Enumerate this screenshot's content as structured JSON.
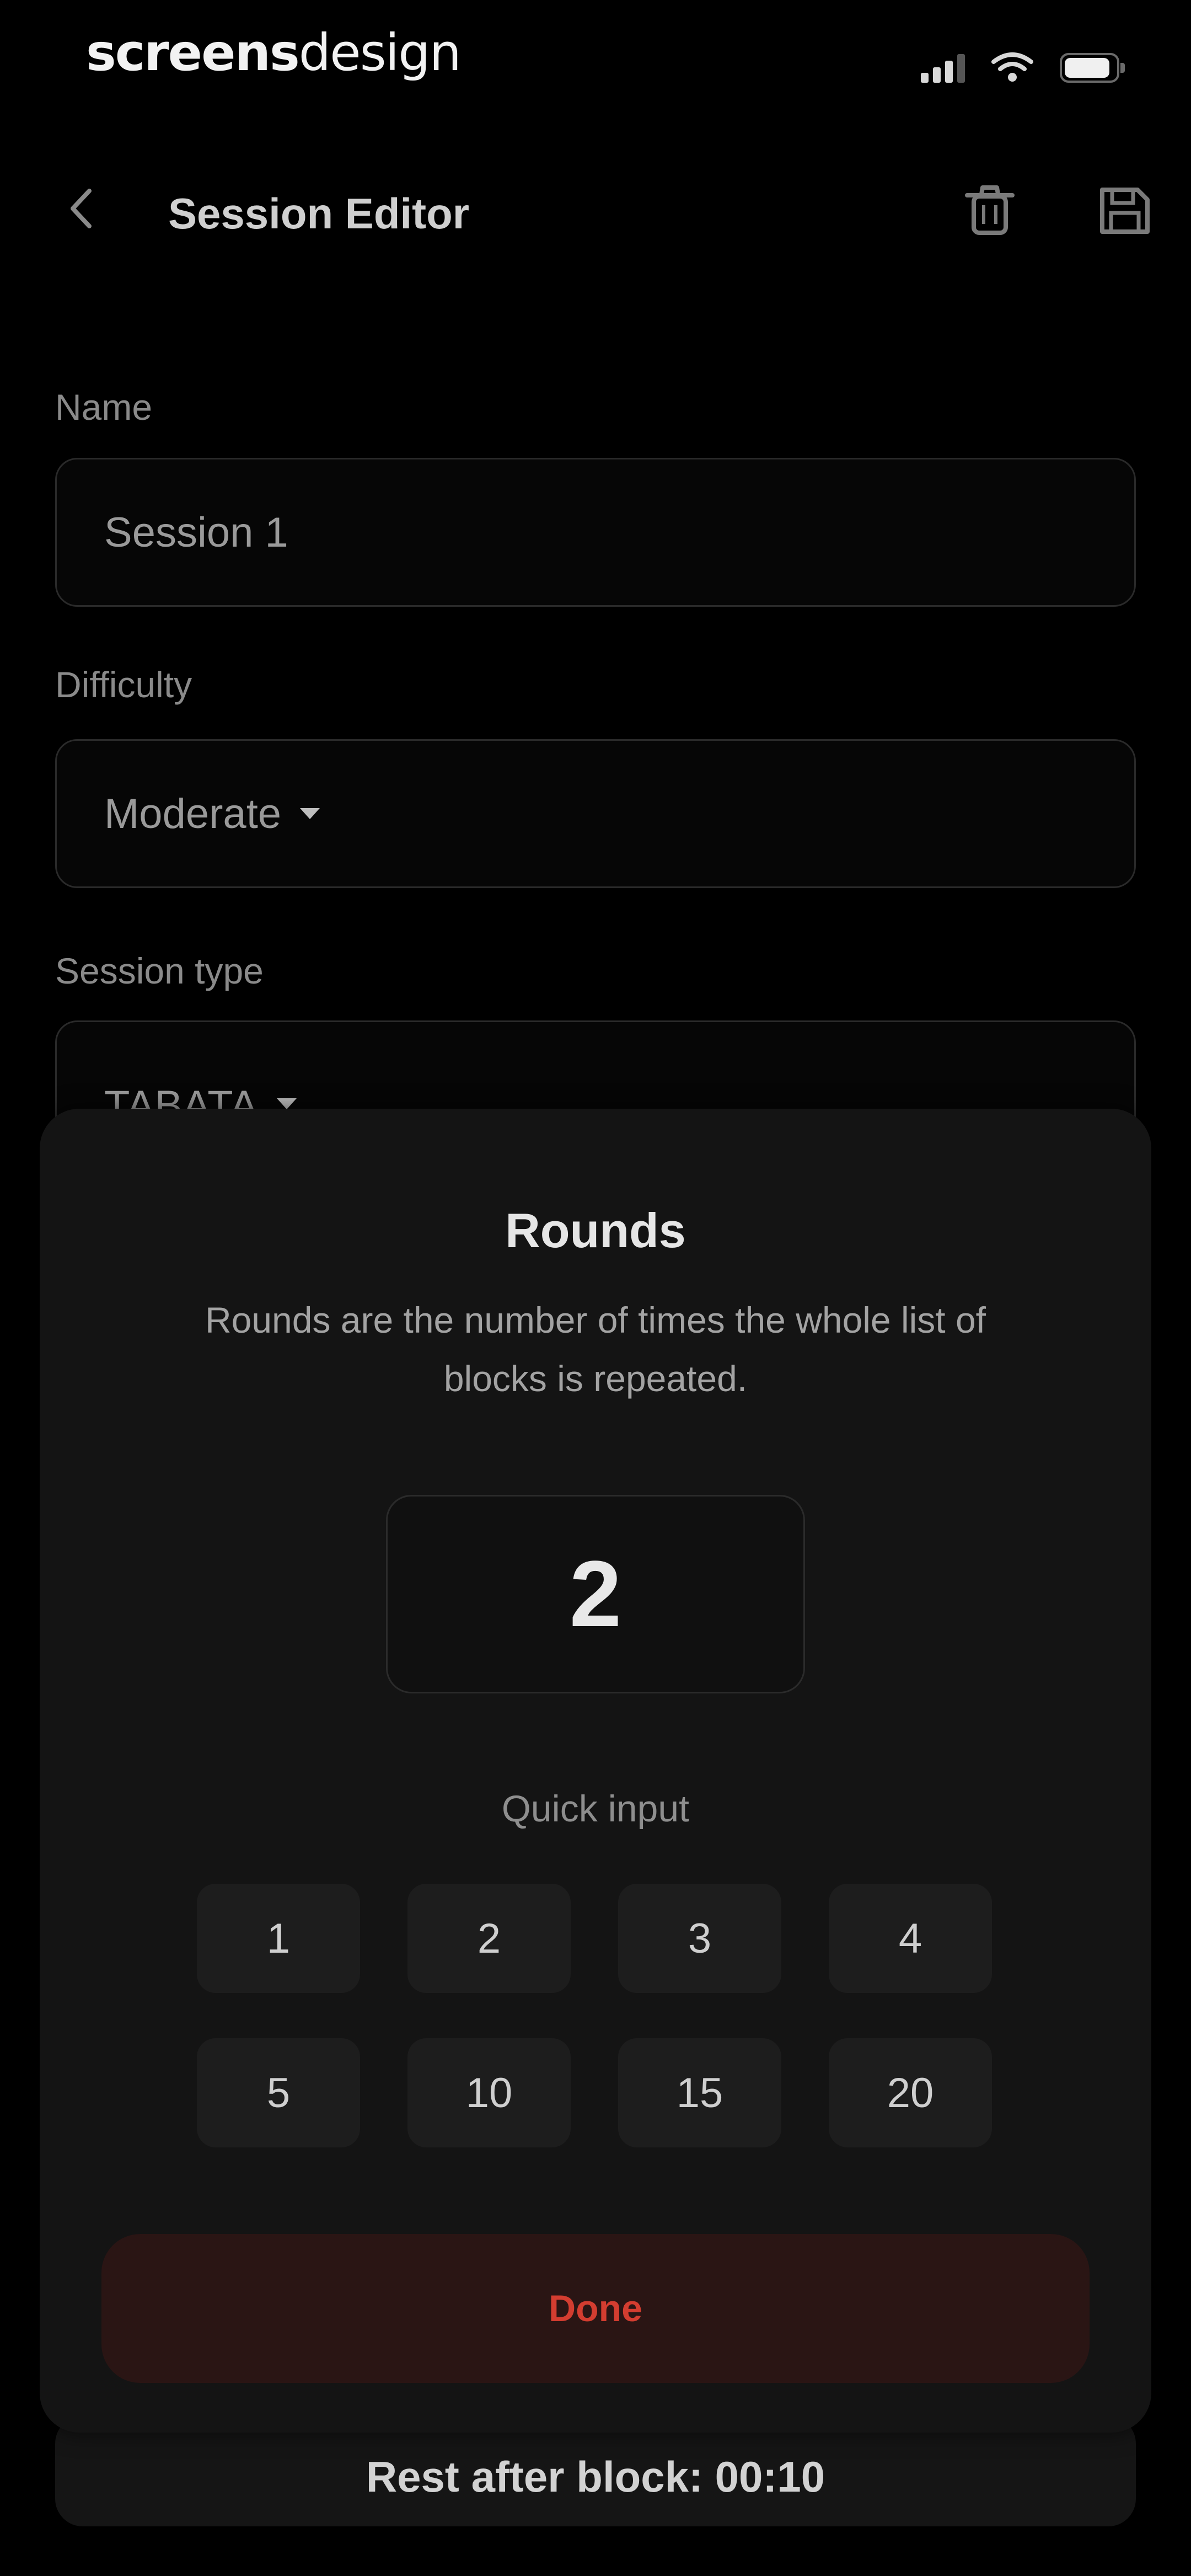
{
  "status_bar": {
    "brand_bold": "screens",
    "brand_light": "design",
    "icons": [
      "signal-icon",
      "wifi-icon",
      "battery-icon"
    ]
  },
  "header": {
    "title": "Session Editor",
    "icons": [
      "back-chevron-icon",
      "trash-icon",
      "save-icon"
    ]
  },
  "form": {
    "name_label": "Name",
    "name_value": "Session 1",
    "difficulty_label": "Difficulty",
    "difficulty_value": "Moderate",
    "session_type_label": "Session type",
    "session_type_value": "TABATA"
  },
  "rest_after_block": "Rest after block: 00:10",
  "sheet": {
    "title": "Rounds",
    "description": "Rounds are the number of times the whole list of blocks is repeated.",
    "value": "2",
    "quick_input_label": "Quick input",
    "quick_options": [
      "1",
      "2",
      "3",
      "4",
      "5",
      "10",
      "15",
      "20"
    ],
    "done_label": "Done"
  },
  "colors": {
    "background": "#000000",
    "sheet": "#141414",
    "accent": "#d33d30",
    "accent_bg": "#2a1514"
  }
}
